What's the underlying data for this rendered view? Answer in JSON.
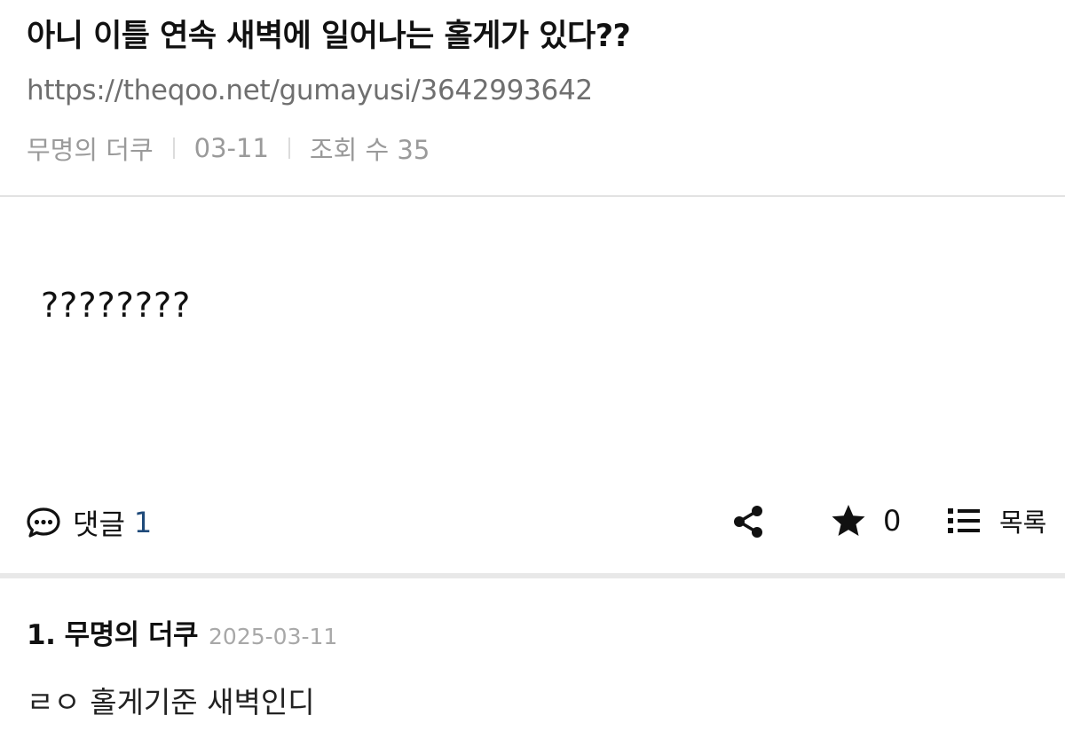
{
  "post": {
    "title": "아니 이틀 연속 새벽에 일어나는 홀게가 있다??",
    "url": "https://theqoo.net/gumayusi/3642993642",
    "author": "무명의 더쿠",
    "date": "03-11",
    "views": "조회 수 35",
    "body": "????????"
  },
  "actions": {
    "comment_icon": "speech-bubble-icon",
    "comment_label": "댓글",
    "comment_count": "1",
    "share_icon": "share-icon",
    "star_icon": "star-icon",
    "star_count": "0",
    "list_icon": "list-icon",
    "list_label": "목록"
  },
  "comments": [
    {
      "author": "1. 무명의 더쿠",
      "date": "2025-03-11",
      "text": "ㄹㅇ 홀게기준 새벽인디"
    }
  ],
  "colors": {
    "comment_count": "#1f4a7a",
    "meta_text": "#9a9a9a",
    "divider": "#e2e2e2"
  }
}
